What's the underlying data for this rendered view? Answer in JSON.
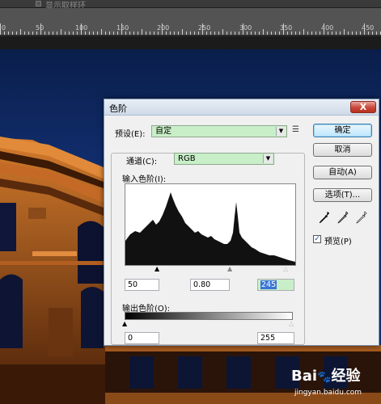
{
  "options_bar": {
    "label": "显示取样环"
  },
  "ruler": {
    "ticks": [
      "0",
      "50",
      "100",
      "150",
      "200",
      "250",
      "300",
      "350",
      "400",
      "450",
      "500",
      "550",
      "600",
      "650"
    ]
  },
  "dialog": {
    "title": "色阶",
    "close_glyph": "X",
    "preset_label": "预设(E):",
    "preset_value": "自定",
    "channel_label": "通道(C):",
    "channel_value": "RGB",
    "input_levels_label": "输入色阶(I):",
    "input_black": "50",
    "input_gamma": "0.80",
    "input_white": "245",
    "output_levels_label": "输出色阶(O):",
    "output_black": "0",
    "output_white": "255",
    "buttons": {
      "ok": "确定",
      "cancel": "取消",
      "auto": "自动(A)",
      "options": "选项(T)..."
    },
    "preview_label": "预览(P)",
    "preview_checked": true
  },
  "watermark": {
    "logo": "Bai",
    "logo_suffix": "经验",
    "url": "jingyan.baidu.com"
  }
}
